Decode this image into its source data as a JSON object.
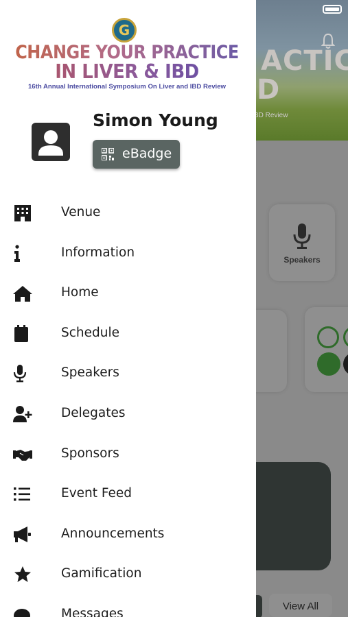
{
  "background": {
    "hero_title": "ACTICE",
    "hero_sub": "D",
    "hero_tag": "BD Review",
    "tile_speakers_label": "Speakers",
    "view_all_label": "View All"
  },
  "drawer": {
    "logo": {
      "line1": "CHANGE YOUR PRACTICE",
      "line2": "IN LIVER & IBD",
      "tagline": "16th Annual International Symposium On Liver and IBD Review"
    },
    "user": {
      "name": "Simon Young",
      "badge_label": "eBadge"
    },
    "menu": [
      {
        "label": "Venue",
        "icon": "building-icon"
      },
      {
        "label": "Information",
        "icon": "info-icon"
      },
      {
        "label": "Home",
        "icon": "home-icon"
      },
      {
        "label": "Schedule",
        "icon": "calendar-icon"
      },
      {
        "label": "Speakers",
        "icon": "microphone-icon"
      },
      {
        "label": "Delegates",
        "icon": "user-plus-icon"
      },
      {
        "label": "Sponsors",
        "icon": "handshake-icon"
      },
      {
        "label": "Event Feed",
        "icon": "list-icon"
      },
      {
        "label": "Announcements",
        "icon": "megaphone-icon"
      },
      {
        "label": "Gamification",
        "icon": "star-icon"
      },
      {
        "label": "Messages",
        "icon": "chat-icon"
      }
    ]
  },
  "colors": {
    "badge_bg": "#5a6562",
    "overlay": "#8a8a8a",
    "dark_card": "#2f3533"
  }
}
